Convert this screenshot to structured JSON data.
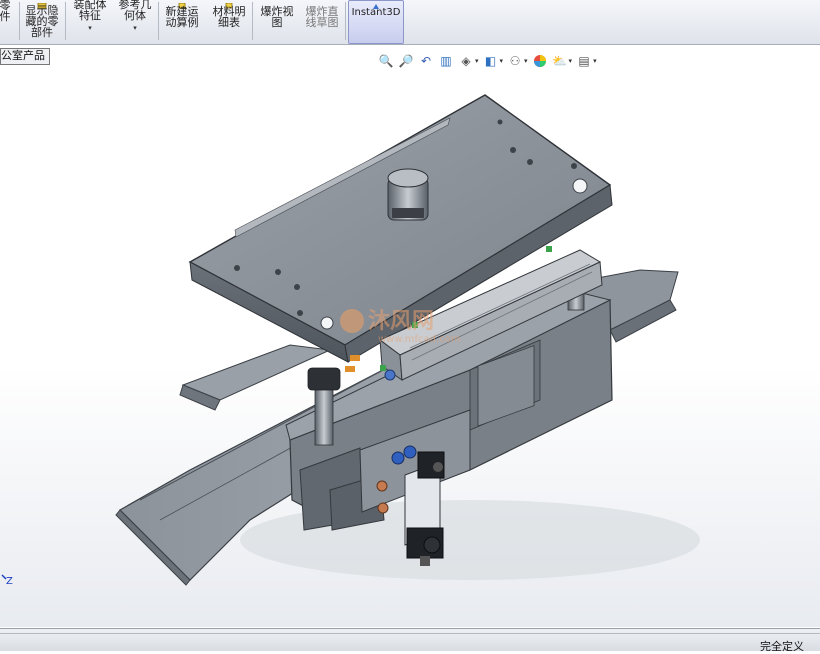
{
  "ribbon": {
    "buttons": [
      {
        "id": "partial",
        "line1": "零",
        "line2": "件",
        "line3": ""
      },
      {
        "id": "show-hidden",
        "line1": "显示隐",
        "line2": "藏的零",
        "line3": "部件"
      },
      {
        "id": "assembly-feature",
        "line1": "装配体",
        "line2": "特征",
        "line3": ""
      },
      {
        "id": "reference-geometry",
        "line1": "参考几",
        "line2": "何体",
        "line3": ""
      },
      {
        "id": "new-motion-study",
        "line1": "新建运",
        "line2": "动算例",
        "line3": ""
      },
      {
        "id": "bom",
        "line1": "材料明",
        "line2": "细表",
        "line3": ""
      },
      {
        "id": "exploded-view",
        "line1": "爆炸视",
        "line2": "图",
        "line3": ""
      },
      {
        "id": "explode-line-sketch",
        "line1": "爆炸直",
        "line2": "线草图",
        "line3": ""
      },
      {
        "id": "instant3d",
        "line1": "Instant3D",
        "line2": "",
        "line3": ""
      }
    ],
    "dropdown_arrow": "▾"
  },
  "tree_tab": {
    "label": "公室产品"
  },
  "hud_icons": [
    "zoom-to-fit-icon",
    "zoom-to-area-icon",
    "previous-view-icon",
    "section-view-icon",
    "view-orientation-icon",
    "display-style-icon",
    "hide-show-items-icon",
    "edit-appearance-icon",
    "apply-scene-icon",
    "view-settings-icon"
  ],
  "watermark": {
    "brand": "沐风网",
    "url": "www.mfcad.com"
  },
  "triad": {
    "axis_label": "Z"
  },
  "statusbar": {
    "text": "完全定义"
  }
}
